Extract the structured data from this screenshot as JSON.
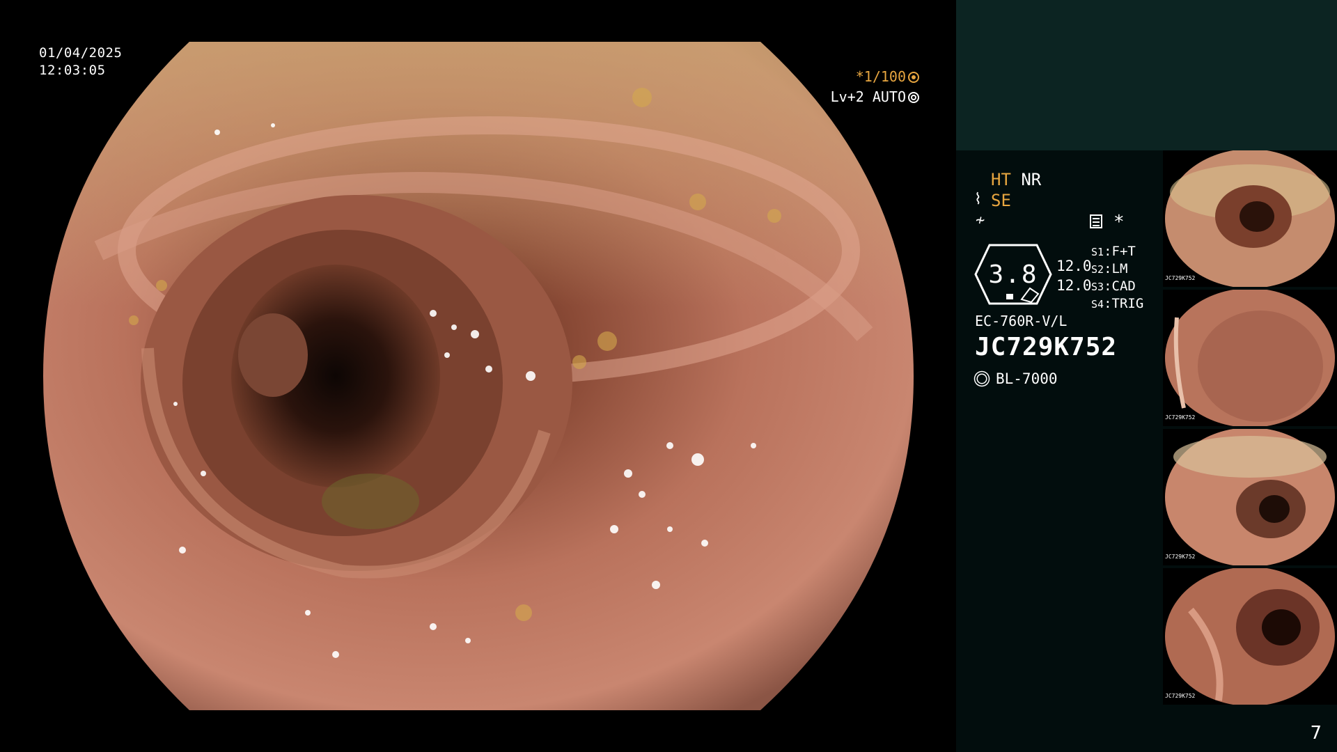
{
  "overlay": {
    "date": "01/04/2025",
    "time": "12:03:05",
    "shutter": "*1/100",
    "auto_level": "Lv+2 AUTO"
  },
  "panel": {
    "ht": "HT",
    "nr": "NR",
    "se": "SE",
    "star": "*",
    "hex_value": "3.8",
    "enhance_1": "12.0",
    "enhance_2": "12.0",
    "switches": [
      {
        "key": "S1",
        "label": "F+T"
      },
      {
        "key": "S2",
        "label": "LM"
      },
      {
        "key": "S3",
        "label": "CAD"
      },
      {
        "key": "S4",
        "label": "TRIG"
      }
    ],
    "scope_model": "EC-760R-V/L",
    "serial": "JC729K752",
    "light_source": "BL-7000"
  },
  "thumbnails": [
    {
      "id": "JC729K752"
    },
    {
      "id": "JC729K752"
    },
    {
      "id": "JC729K752"
    },
    {
      "id": "JC729K752"
    }
  ],
  "page_number": "7",
  "colors": {
    "accent": "#e8a640",
    "panel_top": "#0c2422",
    "panel": "#020d0d"
  }
}
